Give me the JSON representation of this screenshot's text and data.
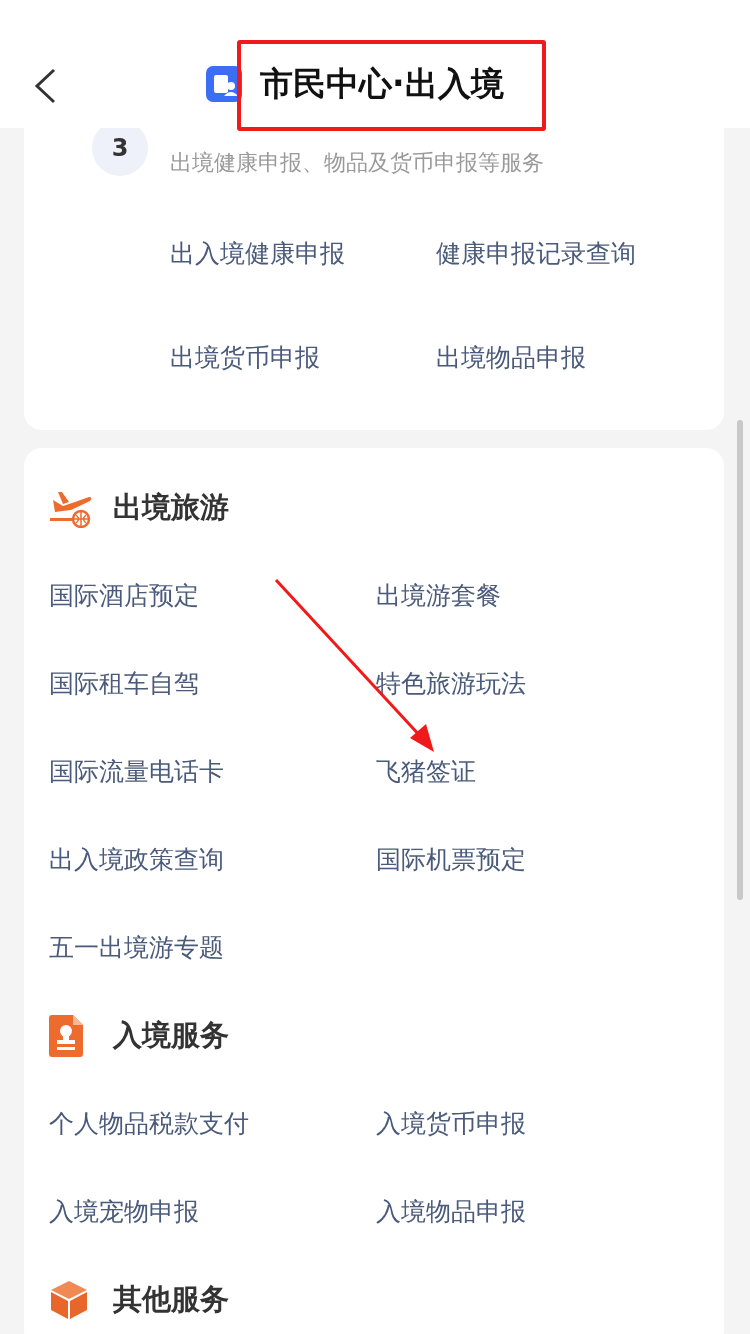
{
  "header": {
    "title": "市民中心·出入境"
  },
  "declaration_card": {
    "step": "3",
    "subtitle": "出境健康申报、物品及货币申报等服务",
    "links": [
      "出入境健康申报",
      "健康申报记录查询",
      "出境货币申报",
      "出境物品申报"
    ]
  },
  "sections": [
    {
      "kind": "travel",
      "title": "出境旅游",
      "items": [
        "国际酒店预定",
        "出境游套餐",
        "国际租车自驾",
        "特色旅游玩法",
        "国际流量电话卡",
        "飞猪签证",
        "出入境政策查询",
        "国际机票预定",
        "五一出境游专题"
      ]
    },
    {
      "kind": "entry",
      "title": "入境服务",
      "items": [
        "个人物品税款支付",
        "入境货币申报",
        "入境宠物申报",
        "入境物品申报"
      ]
    },
    {
      "kind": "other",
      "title": "其他服务"
    }
  ]
}
